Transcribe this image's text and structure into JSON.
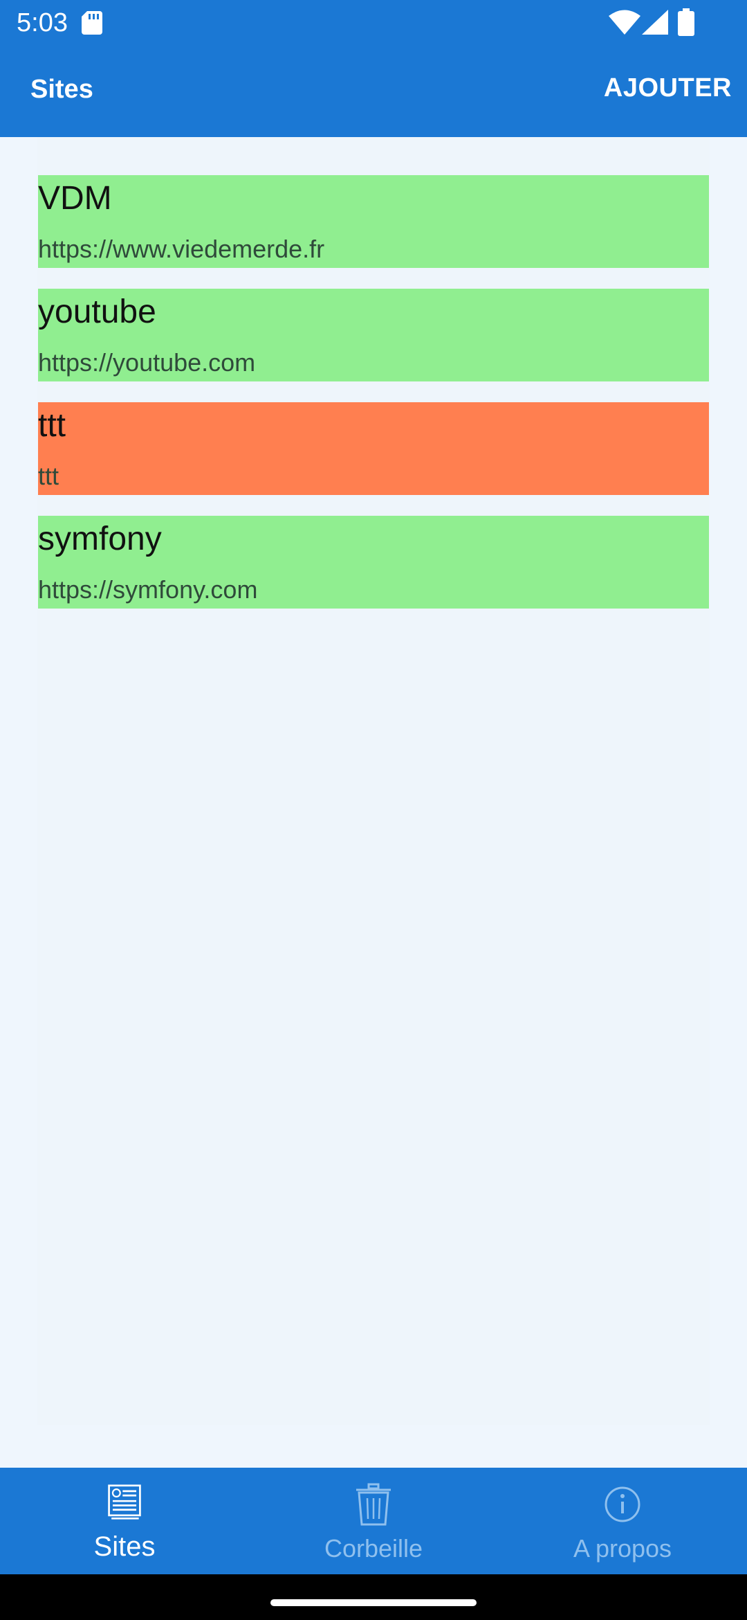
{
  "status_bar": {
    "time": "5:03",
    "icons": [
      "sd-card-icon",
      "wifi-icon",
      "signal-icon",
      "battery-icon"
    ]
  },
  "app_bar": {
    "title": "Sites",
    "action_label": "AJOUTER"
  },
  "colors": {
    "primary": "#1b78d4",
    "active_site": "#90ee90",
    "inactive_site": "#ff7f50",
    "background": "#eff6fd"
  },
  "sites": [
    {
      "name": "VDM",
      "url": "https://www.viedemerde.fr",
      "color": "#90ee90"
    },
    {
      "name": "youtube",
      "url": "https://youtube.com",
      "color": "#90ee90"
    },
    {
      "name": "ttt",
      "url": "ttt",
      "color": "#ff7f50"
    },
    {
      "name": "symfony",
      "url": "https://symfony.com",
      "color": "#90ee90"
    }
  ],
  "bottom_nav": {
    "items": [
      {
        "label": "Sites",
        "icon": "news-icon",
        "active": true
      },
      {
        "label": "Corbeille",
        "icon": "trash-icon",
        "active": false
      },
      {
        "label": "A propos",
        "icon": "info-icon",
        "active": false
      }
    ]
  }
}
